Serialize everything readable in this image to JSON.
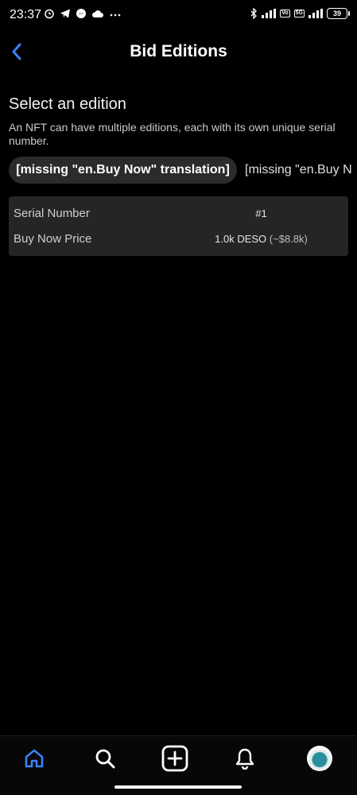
{
  "status_bar": {
    "time": "23:37",
    "battery": "39",
    "network_tags": [
      "Vo",
      "5G"
    ]
  },
  "header": {
    "title": "Bid Editions"
  },
  "section": {
    "title": "Select an edition",
    "description": "An NFT can have multiple editions, each with its own unique serial number."
  },
  "tabs": [
    {
      "label": "[missing \"en.Buy Now\" translation]",
      "active": true
    },
    {
      "label": "[missing \"en.Buy N",
      "active": false
    }
  ],
  "details": {
    "serial_label": "Serial Number",
    "serial_value": "#1",
    "price_label": "Buy Now Price",
    "price_deso": "1.0k DESO",
    "price_usd": "(~$8.8k)"
  },
  "bottom_nav": {
    "items": [
      "home-icon",
      "search-icon",
      "create-icon",
      "bell-icon",
      "avatar"
    ],
    "active": "home-icon"
  },
  "colors": {
    "accent": "#3b82f6",
    "background": "#000000",
    "card": "#252527",
    "tab_active": "#2b2b2d"
  }
}
